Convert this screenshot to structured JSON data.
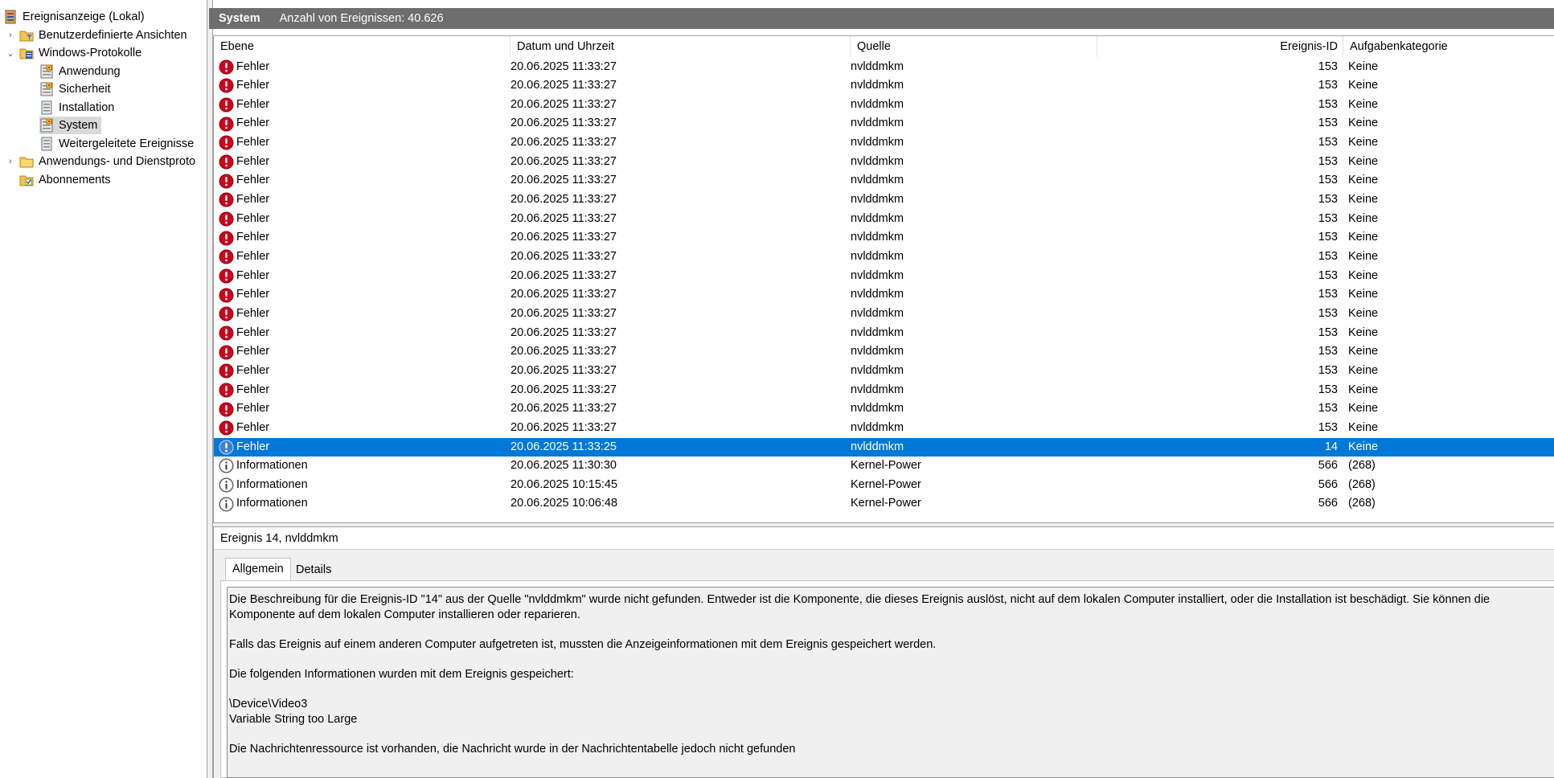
{
  "tree": {
    "items": [
      {
        "label": "Ereignisanzeige (Lokal)",
        "icon": "event-viewer-icon",
        "expander": "",
        "selected": false
      },
      {
        "label": "Benutzerdefinierte Ansichten",
        "icon": "folder-filter-icon",
        "expander": "›",
        "selected": false
      },
      {
        "label": "Windows-Protokolle",
        "icon": "folder-logs-icon",
        "expander": "⌄",
        "selected": false
      },
      {
        "label": "Anwendung",
        "icon": "log-icon",
        "expander": "",
        "selected": false
      },
      {
        "label": "Sicherheit",
        "icon": "log-icon",
        "expander": "",
        "selected": false
      },
      {
        "label": "Installation",
        "icon": "log-plain-icon",
        "expander": "",
        "selected": false
      },
      {
        "label": "System",
        "icon": "log-icon",
        "expander": "",
        "selected": true
      },
      {
        "label": "Weitergeleitete Ereignisse",
        "icon": "log-plain-icon",
        "expander": "",
        "selected": false
      },
      {
        "label": "Anwendungs- und Dienstproto",
        "icon": "folder-icon",
        "expander": "›",
        "selected": false
      },
      {
        "label": "Abonnements",
        "icon": "subscriptions-icon",
        "expander": "",
        "selected": false
      }
    ]
  },
  "header": {
    "log_name": "System",
    "event_count": "Anzahl von Ereignissen: 40.626"
  },
  "columns": {
    "level": "Ebene",
    "datetime": "Datum und Uhrzeit",
    "source": "Quelle",
    "event_id": "Ereignis-ID",
    "category": "Aufgabenkategorie"
  },
  "events": [
    {
      "level": "Fehler",
      "type": "error",
      "datetime": "20.06.2025 11:33:27",
      "source": "nvlddmkm",
      "event_id": "153",
      "category": "Keine"
    },
    {
      "level": "Fehler",
      "type": "error",
      "datetime": "20.06.2025 11:33:27",
      "source": "nvlddmkm",
      "event_id": "153",
      "category": "Keine"
    },
    {
      "level": "Fehler",
      "type": "error",
      "datetime": "20.06.2025 11:33:27",
      "source": "nvlddmkm",
      "event_id": "153",
      "category": "Keine"
    },
    {
      "level": "Fehler",
      "type": "error",
      "datetime": "20.06.2025 11:33:27",
      "source": "nvlddmkm",
      "event_id": "153",
      "category": "Keine"
    },
    {
      "level": "Fehler",
      "type": "error",
      "datetime": "20.06.2025 11:33:27",
      "source": "nvlddmkm",
      "event_id": "153",
      "category": "Keine"
    },
    {
      "level": "Fehler",
      "type": "error",
      "datetime": "20.06.2025 11:33:27",
      "source": "nvlddmkm",
      "event_id": "153",
      "category": "Keine"
    },
    {
      "level": "Fehler",
      "type": "error",
      "datetime": "20.06.2025 11:33:27",
      "source": "nvlddmkm",
      "event_id": "153",
      "category": "Keine"
    },
    {
      "level": "Fehler",
      "type": "error",
      "datetime": "20.06.2025 11:33:27",
      "source": "nvlddmkm",
      "event_id": "153",
      "category": "Keine"
    },
    {
      "level": "Fehler",
      "type": "error",
      "datetime": "20.06.2025 11:33:27",
      "source": "nvlddmkm",
      "event_id": "153",
      "category": "Keine"
    },
    {
      "level": "Fehler",
      "type": "error",
      "datetime": "20.06.2025 11:33:27",
      "source": "nvlddmkm",
      "event_id": "153",
      "category": "Keine"
    },
    {
      "level": "Fehler",
      "type": "error",
      "datetime": "20.06.2025 11:33:27",
      "source": "nvlddmkm",
      "event_id": "153",
      "category": "Keine"
    },
    {
      "level": "Fehler",
      "type": "error",
      "datetime": "20.06.2025 11:33:27",
      "source": "nvlddmkm",
      "event_id": "153",
      "category": "Keine"
    },
    {
      "level": "Fehler",
      "type": "error",
      "datetime": "20.06.2025 11:33:27",
      "source": "nvlddmkm",
      "event_id": "153",
      "category": "Keine"
    },
    {
      "level": "Fehler",
      "type": "error",
      "datetime": "20.06.2025 11:33:27",
      "source": "nvlddmkm",
      "event_id": "153",
      "category": "Keine"
    },
    {
      "level": "Fehler",
      "type": "error",
      "datetime": "20.06.2025 11:33:27",
      "source": "nvlddmkm",
      "event_id": "153",
      "category": "Keine"
    },
    {
      "level": "Fehler",
      "type": "error",
      "datetime": "20.06.2025 11:33:27",
      "source": "nvlddmkm",
      "event_id": "153",
      "category": "Keine"
    },
    {
      "level": "Fehler",
      "type": "error",
      "datetime": "20.06.2025 11:33:27",
      "source": "nvlddmkm",
      "event_id": "153",
      "category": "Keine"
    },
    {
      "level": "Fehler",
      "type": "error",
      "datetime": "20.06.2025 11:33:27",
      "source": "nvlddmkm",
      "event_id": "153",
      "category": "Keine"
    },
    {
      "level": "Fehler",
      "type": "error",
      "datetime": "20.06.2025 11:33:27",
      "source": "nvlddmkm",
      "event_id": "153",
      "category": "Keine"
    },
    {
      "level": "Fehler",
      "type": "error",
      "datetime": "20.06.2025 11:33:27",
      "source": "nvlddmkm",
      "event_id": "153",
      "category": "Keine"
    },
    {
      "level": "Fehler",
      "type": "error",
      "datetime": "20.06.2025 11:33:25",
      "source": "nvlddmkm",
      "event_id": "14",
      "category": "Keine",
      "selected": true
    },
    {
      "level": "Informationen",
      "type": "info",
      "datetime": "20.06.2025 11:30:30",
      "source": "Kernel-Power",
      "event_id": "566",
      "category": "(268)"
    },
    {
      "level": "Informationen",
      "type": "info",
      "datetime": "20.06.2025 10:15:45",
      "source": "Kernel-Power",
      "event_id": "566",
      "category": "(268)"
    },
    {
      "level": "Informationen",
      "type": "info",
      "datetime": "20.06.2025 10:06:48",
      "source": "Kernel-Power",
      "event_id": "566",
      "category": "(268)"
    }
  ],
  "detail": {
    "title": "Ereignis 14, nvlddmkm",
    "tabs": [
      "Allgemein",
      "Details"
    ],
    "paragraphs": [
      "Die Beschreibung für die Ereignis-ID \"14\" aus der Quelle \"nvlddmkm\" wurde nicht gefunden. Entweder ist die Komponente, die dieses Ereignis auslöst, nicht auf dem lokalen Computer installiert, oder die Installation ist beschädigt. Sie können die Komponente auf dem lokalen Computer installieren oder reparieren.",
      "Falls das Ereignis auf einem anderen Computer aufgetreten ist, mussten die Anzeigeinformationen mit dem Ereignis gespeichert werden.",
      "Die folgenden Informationen wurden mit dem Ereignis gespeichert:",
      "\\Device\\Video3\nVariable String too Large",
      "Die Nachrichtenressource ist vorhanden, die Nachricht wurde in der Nachrichtentabelle jedoch nicht gefunden"
    ]
  },
  "colors": {
    "header_bg": "#6e6e6e",
    "selection": "#0078d7",
    "error_red": "#d0021b",
    "info_gray": "#5a5a5a"
  }
}
